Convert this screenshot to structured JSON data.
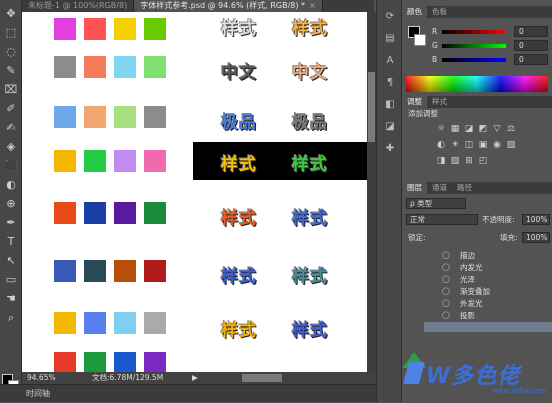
{
  "tabs": [
    {
      "label": "未标题-1 @ 100%(RGB/8)",
      "active": false
    },
    {
      "label": "字体样式参考.psd @ 94.6% (样式, RGB/8) *",
      "active": true
    }
  ],
  "tab_close": "×",
  "tools": [
    "✥",
    "⬚",
    "◌",
    "✎",
    "⌧",
    "✐",
    "✍",
    "◈",
    "⬛",
    "◐",
    "⊕",
    "✒",
    "T",
    "↖",
    "▭",
    "☚",
    "⌕"
  ],
  "swatches": [
    [
      "#e040e0",
      "#ff5252",
      "#f5d000",
      "#66cc00"
    ],
    [
      "#8c8c8c",
      "#f47c5a",
      "#7ed6f0",
      "#7fe070"
    ],
    [
      "#6fa8e8",
      "#f0a870",
      "#a8e080",
      "#8c8c8c"
    ],
    [
      "#f5b800",
      "#22cc44",
      "#c08cf0",
      "#f06ab0"
    ],
    [
      "#e84a1a",
      "#1a40a8",
      "#5a1aa0",
      "#1a8a3a"
    ],
    [
      "#3a5ab8",
      "#2a4a58",
      "#b8500a",
      "#b01a1a"
    ],
    [
      "#f5b800",
      "#5a80f0",
      "#7ed0f0",
      "#aaaaaa"
    ],
    [
      "#e83a2a",
      "#1a9a3a",
      "#1a5acc",
      "#7a2ac0"
    ]
  ],
  "styles": [
    {
      "left": "样式",
      "right": "样式",
      "lc": "#e0e0e0",
      "rc": "#f5b040"
    },
    {
      "left": "中文",
      "right": "中文",
      "lc": "#555555",
      "rc": "#e8a878"
    },
    {
      "left": "极品",
      "right": "极品",
      "lc": "#4a7ad8",
      "rc": "#777777"
    },
    {
      "left": "样式",
      "right": "样式",
      "lc": "#f5c000",
      "rc": "#33cc33"
    },
    {
      "left": "样式",
      "right": "样式",
      "lc": "#e85a20",
      "rc": "#3a6ad8"
    },
    {
      "left": "样式",
      "right": "样式",
      "lc": "#3a5ad8",
      "rc": "#4a8a9a"
    },
    {
      "left": "样式",
      "right": "样式",
      "lc": "#f5b000",
      "rc": "#3a5ad8"
    }
  ],
  "status": {
    "zoom": "94.65%",
    "doc": "文档:6.78M/129.5M",
    "arrow": "▶"
  },
  "timeline": "时间轴",
  "dock_icons": [
    "⟳",
    "▤",
    "A",
    "¶",
    "◧",
    "◪",
    "✚"
  ],
  "color_panel": {
    "tabs": [
      "颜色",
      "色板"
    ],
    "rows": [
      {
        "label": "R",
        "value": "0",
        "gradient": "linear-gradient(to right,#000,#f00)"
      },
      {
        "label": "G",
        "value": "0",
        "gradient": "linear-gradient(to right,#000,#0f0)"
      },
      {
        "label": "B",
        "value": "0",
        "gradient": "linear-gradient(to right,#000,#00f)"
      }
    ]
  },
  "adjust_panel": {
    "tabs": [
      "调整",
      "样式"
    ],
    "title": "添加调整",
    "icons": [
      "☼",
      "▦",
      "◪",
      "◩",
      "▽",
      "⚖",
      "◐",
      "☀",
      "◫",
      "▣",
      "◉",
      "▨",
      "◨",
      "▧",
      "⊞",
      "◰"
    ]
  },
  "layers_panel": {
    "tabs": [
      "图层",
      "通道",
      "路径"
    ],
    "kind": "ρ 类型",
    "blend": "正常",
    "opacity_label": "不透明度:",
    "opacity": "100%",
    "lock_label": "锁定:",
    "fill_label": "填充:",
    "fill": "100%",
    "effects": [
      "描边",
      "内发光",
      "光泽",
      "渐变叠加",
      "外发光",
      "投影"
    ]
  },
  "watermark": {
    "text": "W多色佬",
    "url": "www.386w.com"
  }
}
